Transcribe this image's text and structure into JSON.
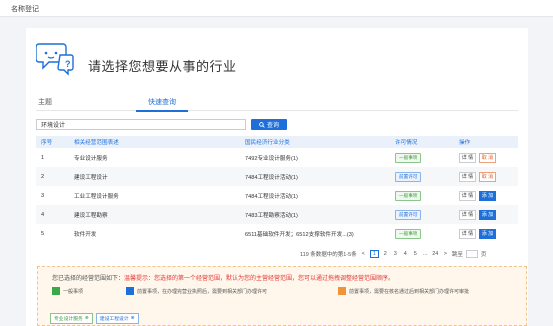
{
  "topbar": {
    "breadcrumb": "名称登记"
  },
  "hero": {
    "title": "请选择您想要从事的行业"
  },
  "tabs": [
    {
      "label": "主题"
    },
    {
      "label": "快速查询"
    }
  ],
  "search": {
    "value": "环境设计",
    "button_label": "查询"
  },
  "table": {
    "headers": [
      "序号",
      "相关经营范围表述",
      "国民经济行业分类",
      "许可情况",
      "操作"
    ],
    "rows": [
      {
        "no": "1",
        "scope": "专业设计服务",
        "industry": "7492专业设计服务(1)",
        "license": "一般事项",
        "license_type": "green",
        "detail": "详 情",
        "action": "取 消",
        "action_type": "cancel"
      },
      {
        "no": "2",
        "scope": "建设工程设计",
        "industry": "7484工程设计活动(1)",
        "license": "前置许可",
        "license_type": "blue",
        "detail": "详 情",
        "action": "取 消",
        "action_type": "cancel"
      },
      {
        "no": "3",
        "scope": "工业工程设计服务",
        "industry": "7484工程设计活动(1)",
        "license": "一般事项",
        "license_type": "green",
        "detail": "详 情",
        "action": "添 加",
        "action_type": "add"
      },
      {
        "no": "4",
        "scope": "建设工程勘察",
        "industry": "7483工程勘察活动(1)",
        "license": "前置许可",
        "license_type": "blue",
        "detail": "详 情",
        "action": "添 加",
        "action_type": "add"
      },
      {
        "no": "5",
        "scope": "软件开发",
        "industry": "6511基础软件开发；6512支撑软件开发...(3)",
        "license": "一般事项",
        "license_type": "green",
        "detail": "详 情",
        "action": "添 加",
        "action_type": "add"
      }
    ]
  },
  "pager": {
    "summary": "119 条数据中的第1-5条",
    "prev": "<",
    "pages": [
      "1",
      "2",
      "3",
      "4",
      "5",
      "...",
      "24"
    ],
    "active_page": "1",
    "next": ">",
    "goto_label": "跳至",
    "page_unit": "页"
  },
  "selection": {
    "intro": "您已选择的经营范围如下：",
    "warning": "温馨提示：您选择的第一个经营范围，默认为您的主营经营范围，您可以通过拖拽调整经营范围顺序。",
    "legend": [
      {
        "color": "green",
        "label": "一般事项"
      },
      {
        "color": "blue",
        "label": "前置事项，在办理完营业执照后，需要到相关部门办理许可"
      },
      {
        "color": "orange",
        "label": "前置事项，需要在核名通过后到相关部门办理许可审批"
      }
    ],
    "chips": [
      {
        "label": "专业设计服务",
        "type": "green"
      },
      {
        "label": "建设工程设计",
        "type": "blue"
      }
    ]
  },
  "colors": {
    "accent": "#1e6fd9",
    "cancel": "#e0622b",
    "general": "#3aa94a",
    "postlicense": "#f0943a"
  }
}
